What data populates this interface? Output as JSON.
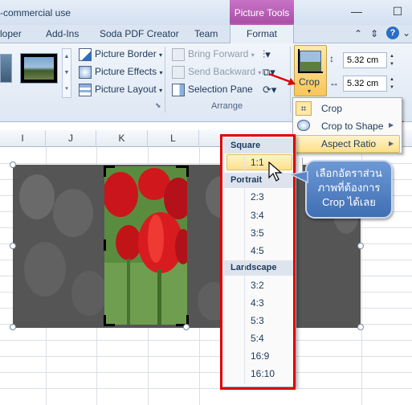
{
  "window": {
    "title": "-commercial use",
    "context_group": "Picture Tools",
    "controls": [
      "—",
      "☐"
    ]
  },
  "tabs": [
    "loper",
    "Add-Ins",
    "Soda PDF Creator",
    "Team",
    "Format"
  ],
  "ribbon": {
    "picture_styles": {
      "border_label": "Picture Border",
      "effects_label": "Picture Effects",
      "layout_label": "Picture Layout"
    },
    "arrange": {
      "bring_forward_label": "Bring Forward",
      "send_backward_label": "Send Backward",
      "selection_pane_label": "Selection Pane",
      "group_label": "Arrange"
    },
    "size": {
      "crop_label": "Crop",
      "height_value": "5.32 cm",
      "width_value": "5.32 cm"
    }
  },
  "sheet": {
    "columns": [
      "I",
      "J",
      "K",
      "L"
    ]
  },
  "crop_menu": {
    "items": [
      "Crop",
      "Crop to Shape",
      "Aspect Ratio"
    ]
  },
  "aspect_ratio_menu": {
    "square_header": "Square",
    "square_items": [
      "1:1"
    ],
    "portrait_header": "Portrait",
    "portrait_items": [
      "2:3",
      "3:4",
      "3:5",
      "4:5"
    ],
    "landscape_header": "Landscape",
    "landscape_items": [
      "3:2",
      "4:3",
      "5:3",
      "5:4",
      "16:9",
      "16:10"
    ]
  },
  "callout": {
    "text": "เลือกอัตราส่วนภาพที่ต้องการ Crop ได้เลย"
  },
  "colors": {
    "accent_red": "#e00000",
    "context_tab": "#b75ab4",
    "highlight": "#fde08b",
    "callout_blue": "#4f7fc2"
  }
}
